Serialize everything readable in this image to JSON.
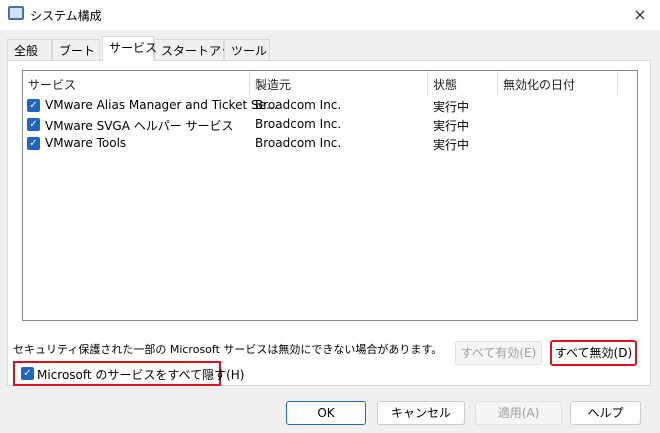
{
  "window": {
    "title": "システム構成",
    "close_icon": "×"
  },
  "tabs": [
    {
      "label": "全般"
    },
    {
      "label": "ブート"
    },
    {
      "label": "サービス"
    },
    {
      "label": "スタートアップ"
    },
    {
      "label": "ツール"
    }
  ],
  "list": {
    "columns": [
      "サービス",
      "製造元",
      "状態",
      "無効化の日付"
    ],
    "rows": [
      {
        "name": "VMware Alias Manager and Ticket Se...",
        "maker": "Broadcom Inc.",
        "status": "実行中",
        "date": "",
        "checked": true
      },
      {
        "name": "VMware SVGA ヘルパー サービス",
        "maker": "Broadcom Inc.",
        "status": "実行中",
        "date": "",
        "checked": true
      },
      {
        "name": "VMware Tools",
        "maker": "Broadcom Inc.",
        "status": "実行中",
        "date": "",
        "checked": true
      }
    ]
  },
  "note": "セキュリティ保護された一部の Microsoft サービスは無効にできない場合があります。",
  "enable_all": "すべて有効(E)",
  "disable_all": "すべて無効(D)",
  "hide_ms": {
    "label": "Microsoft のサービスをすべて隠す(H)",
    "checked": true
  },
  "buttons": {
    "ok": "OK",
    "cancel": "キャンセル",
    "apply": "適用(A)",
    "help": "ヘルプ"
  },
  "colors": {
    "accent": "#1f65c4",
    "highlight": "#e01020"
  }
}
